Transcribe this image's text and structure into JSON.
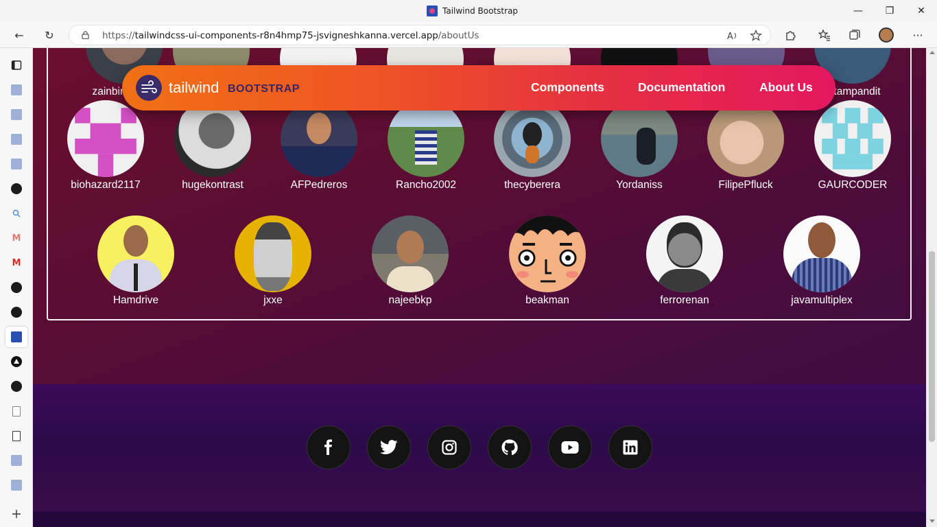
{
  "browser": {
    "window_title": "Tailwind Bootstrap",
    "url_prefix": "https://",
    "url_host": "tailwindcss-ui-components-r8n4hmp75-jsvigneshkanna.vercel.app",
    "url_path": "/aboutUs",
    "controls": {
      "minimize": "—",
      "restore": "❐",
      "close": "✕",
      "back": "←",
      "refresh": "↻",
      "more": "···"
    }
  },
  "navbar": {
    "brand_main": "tailwind",
    "brand_sub": "BOOTSTRAP",
    "links": [
      "Components",
      "Documentation",
      "About Us"
    ]
  },
  "contributors": {
    "row_top_visible": [
      "zainbinfurqan",
      "uttampandit"
    ],
    "row2": [
      "biohazard2117",
      "hugekontrast",
      "AFPedreros",
      "Rancho2002",
      "thecyberera",
      "Yordaniss",
      "FilipePfluck",
      "GAURCODER"
    ],
    "row3": [
      "Hamdrive",
      "jxxe",
      "najeebkp",
      "beakman",
      "ferrorenan",
      "javamultiplex"
    ]
  },
  "footer": {
    "social_icons": [
      "facebook-icon",
      "twitter-icon",
      "instagram-icon",
      "github-icon",
      "youtube-icon",
      "linkedin-icon"
    ]
  },
  "colors": {
    "nav_start": "#f07014",
    "nav_end": "#e3175f",
    "page_bg": "#5a0d33",
    "footer_bg": "#2d0a4a"
  }
}
